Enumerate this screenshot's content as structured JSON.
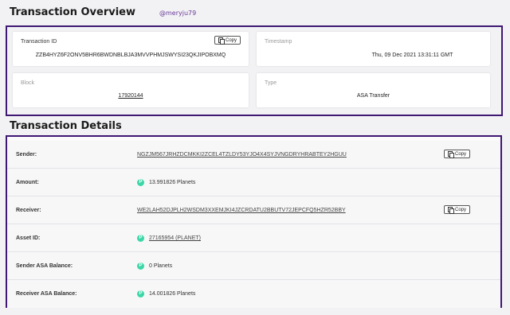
{
  "overview": {
    "title": "Transaction Overview",
    "watermark": "@meryju79",
    "transaction_id": {
      "label": "Transaction ID",
      "value": "ZZB4HYZ6F2ONV5BHR6BWDNBLBJA3MVVPHMJSWYSI23QKJIPOBXMQ",
      "copy_label": "Copy"
    },
    "timestamp": {
      "label": "Timestamp",
      "value": "Thu, 09 Dec 2021 13:31:11 GMT"
    },
    "block": {
      "label": "Block",
      "value": "17920144"
    },
    "type": {
      "label": "Type",
      "value": "ASA Transfer"
    }
  },
  "details": {
    "title": "Transaction Details",
    "sender": {
      "label": "Sender:",
      "value": "NGZJM567JRHZDCMKKI2ZCEL4TZLDY53YJO4X4SYJVNGDRYHRABTEY2HGUU",
      "copy_label": "Copy"
    },
    "amount": {
      "label": "Amount:",
      "value": "13.991826 Planets"
    },
    "receiver": {
      "label": "Receiver:",
      "value": "WE2LAH52DJPLH2WSDM3XXEMJKI4JZCRDATU2BBUTV72JEPCFQ5HZR52BBY",
      "copy_label": "Copy"
    },
    "asset_id": {
      "label": "Asset ID:",
      "value": "27165954 (PLANET)"
    },
    "sender_balance": {
      "label": "Sender ASA Balance:",
      "value": "0 Planets"
    },
    "receiver_balance": {
      "label": "Receiver ASA Balance:",
      "value": "14.001826 Planets"
    },
    "planet_icon_glyph": "P",
    "planet_icon_color": "#3dd6a6"
  },
  "colors": {
    "frame_border": "#3f1873",
    "background": "#f2f2f4"
  },
  "icons": {
    "copy": "copy-icon",
    "planet": "planet-token-icon"
  }
}
